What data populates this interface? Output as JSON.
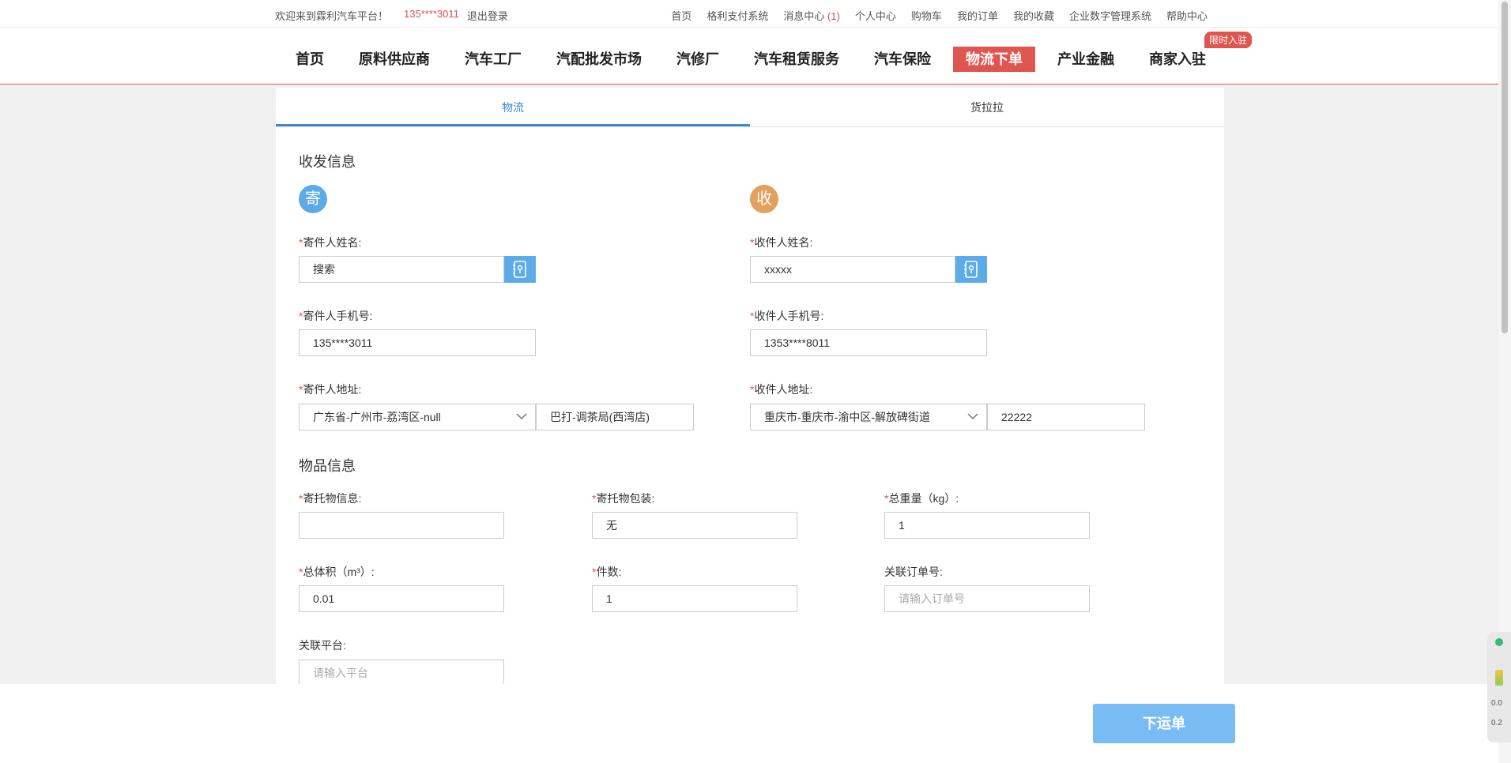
{
  "topbar": {
    "welcome": "欢迎来到霖利汽车平台！",
    "phone": "135****3011",
    "logout": "退出登录",
    "links": [
      "首页",
      "格利支付系统",
      "消息中心",
      "个人中心",
      "购物车",
      "我的订单",
      "我的收藏",
      "企业数字管理系统",
      "帮助中心"
    ],
    "message_count": "(1)"
  },
  "nav": {
    "items": [
      "首页",
      "原料供应商",
      "汽车工厂",
      "汽配批发市场",
      "汽修厂",
      "汽车租赁服务",
      "汽车保险",
      "物流下单",
      "产业金融",
      "商家入驻"
    ],
    "active_index": 7,
    "promo": "限时入驻"
  },
  "tabs": [
    "物流",
    "货拉拉"
  ],
  "sections": {
    "shipping": "收发信息",
    "goods": "物品信息"
  },
  "sender": {
    "badge": "寄",
    "name_label": "寄件人姓名:",
    "name_value": "搜索",
    "phone_label": "寄件人手机号:",
    "phone_value": "135****3011",
    "address_label": "寄件人地址:",
    "address_region": "广东省-广州市-荔湾区-null",
    "address_detail": "巴打-调茶局(西湾店)"
  },
  "receiver": {
    "badge": "收",
    "name_label": "收件人姓名:",
    "name_value": "xxxxx",
    "phone_label": "收件人手机号:",
    "phone_value": "1353****8011",
    "address_label": "收件人地址:",
    "address_region": "重庆市-重庆市-渝中区-解放碑街道",
    "address_detail": "22222"
  },
  "goods": {
    "info_label": "寄托物信息:",
    "info_value": "",
    "package_label": "寄托物包装:",
    "package_value": "无",
    "weight_label": "总重量（kg）:",
    "weight_value": "1",
    "volume_label": "总体积（m³）:",
    "volume_value": "0.01",
    "count_label": "件数:",
    "count_value": "1",
    "order_label": "关联订单号:",
    "order_placeholder": "请输入订单号",
    "platform_label": "关联平台:",
    "platform_placeholder": "请输入平台"
  },
  "submit_label": "下运单",
  "widget": {
    "v1": "0.0",
    "v2": "0.2"
  },
  "colors": {
    "accent_red": "#e0554f",
    "accent_blue": "#3c8ad8",
    "send_circle": "#5aabe8",
    "recv_circle": "#e3a15f",
    "submit": "#79bbf3"
  }
}
